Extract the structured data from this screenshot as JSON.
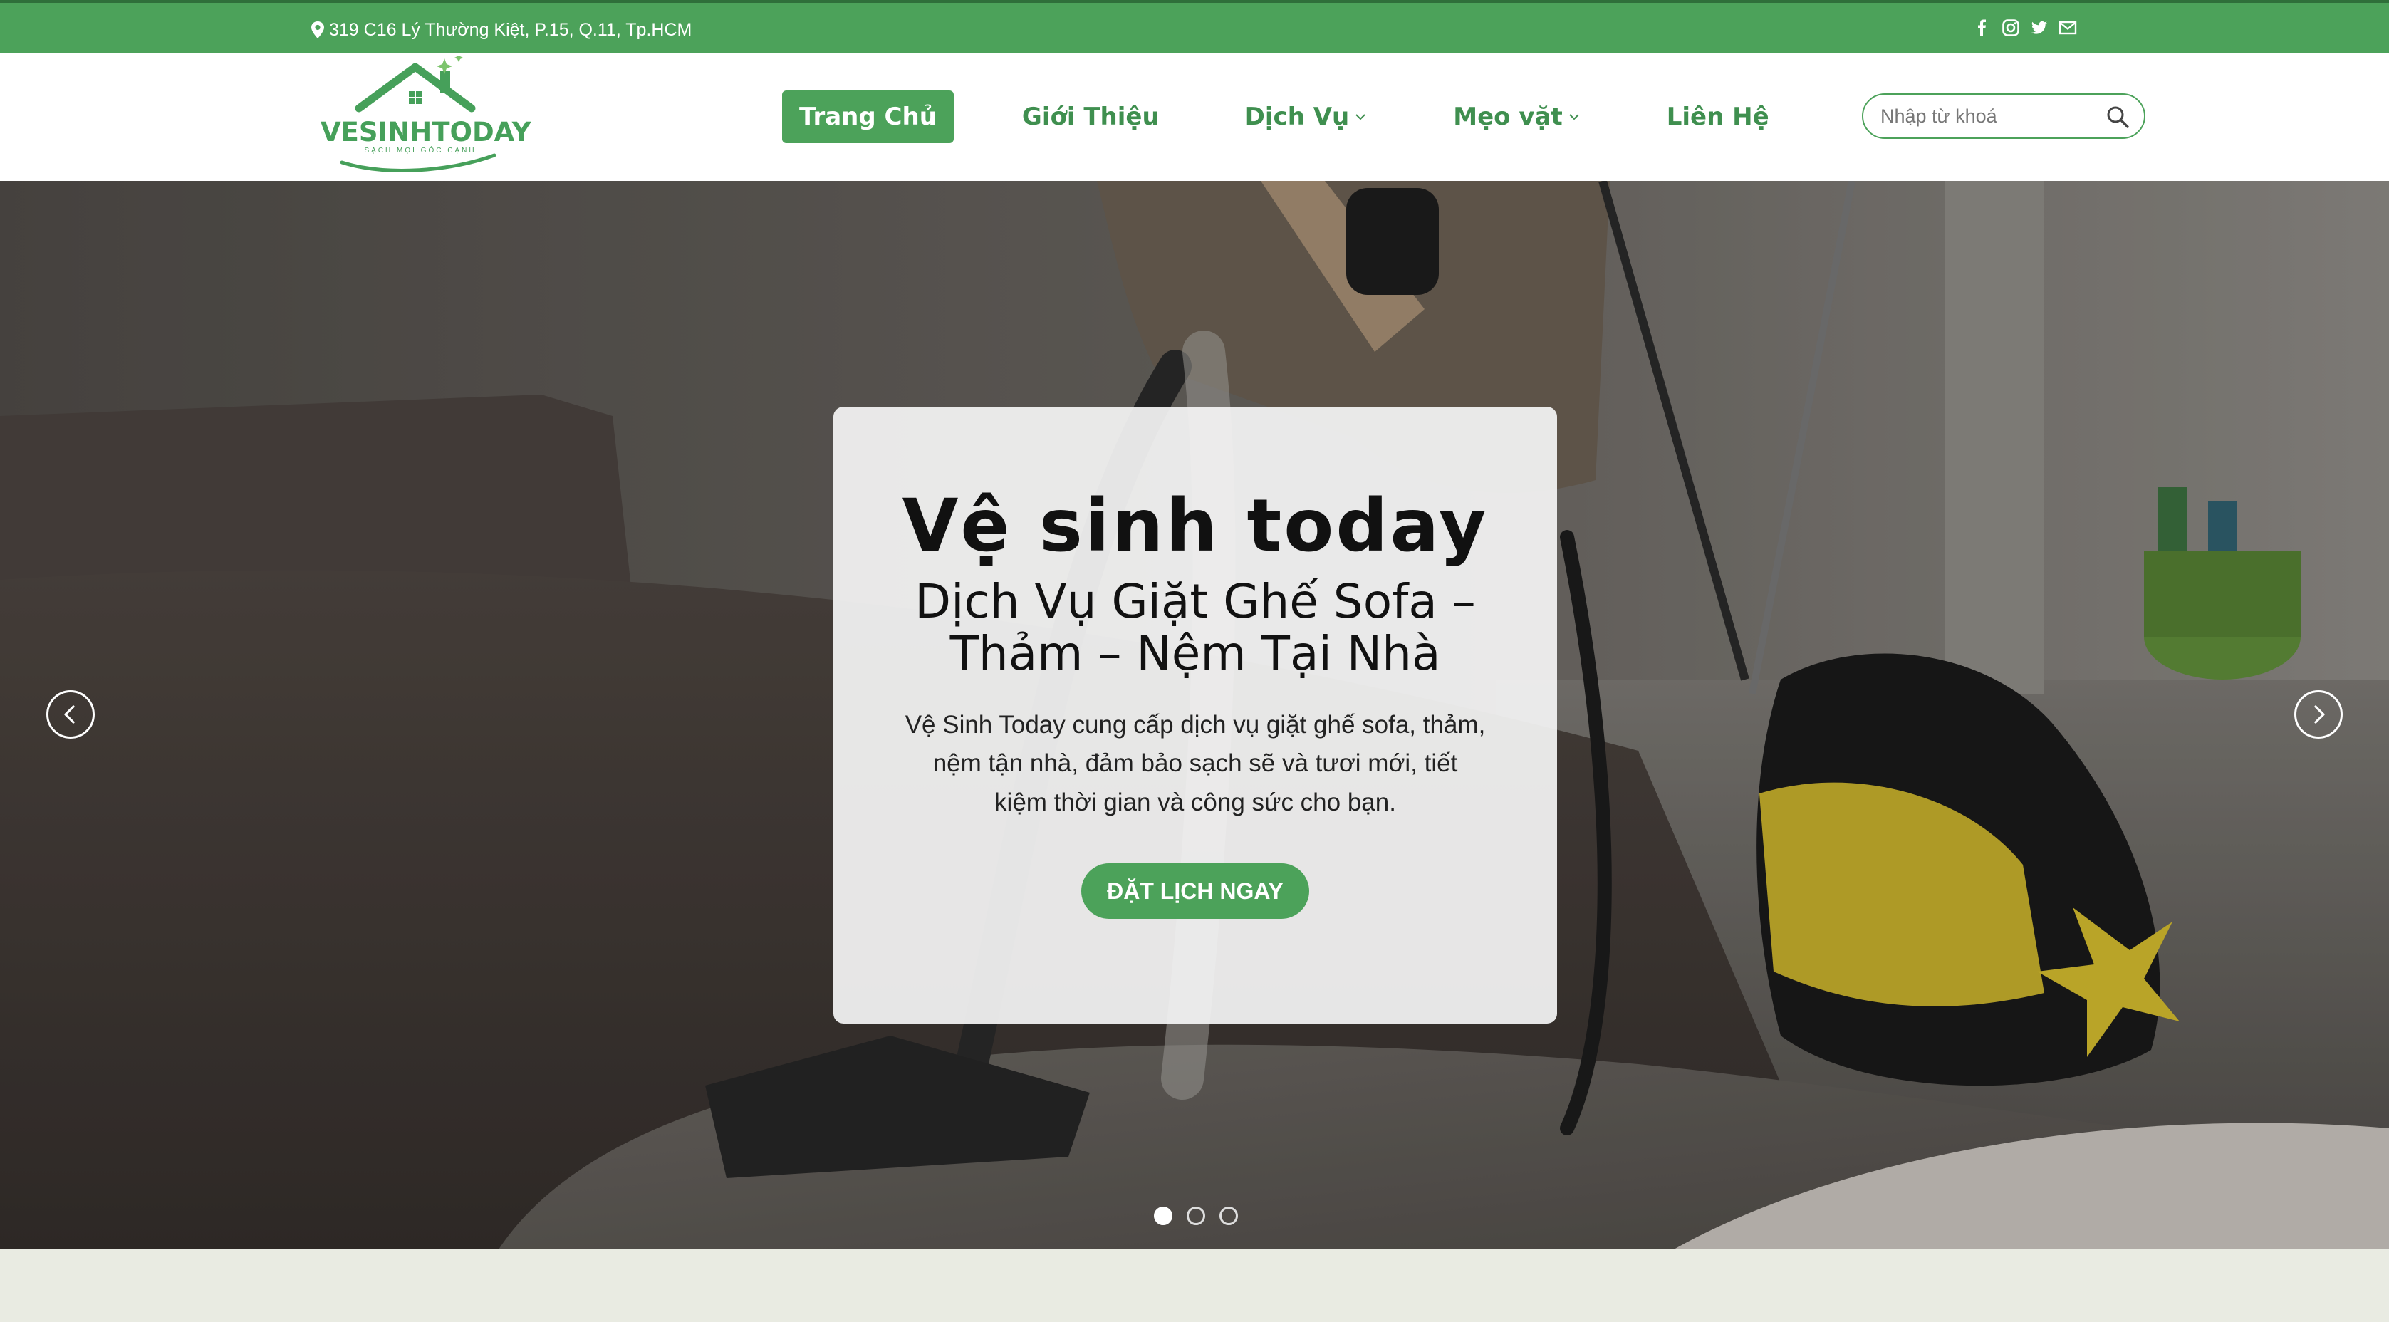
{
  "topbar": {
    "address": "319 C16 Lý Thường Kiệt, P.15, Q.11, Tp.HCM",
    "address_icon": "map-pin-icon",
    "social_icons": [
      "facebook-icon",
      "instagram-icon",
      "twitter-icon",
      "email-icon"
    ]
  },
  "logo": {
    "name": "VESINHTODAY",
    "tagline": "SẠCH MỌI GÓC CẠNH"
  },
  "nav": {
    "items": [
      {
        "label": "Trang Chủ",
        "active": true,
        "dropdown": false
      },
      {
        "label": "Giới Thiệu",
        "active": false,
        "dropdown": false
      },
      {
        "label": "Dịch Vụ",
        "active": false,
        "dropdown": true
      },
      {
        "label": "Mẹo vặt",
        "active": false,
        "dropdown": true
      },
      {
        "label": "Liên Hệ",
        "active": false,
        "dropdown": false
      }
    ]
  },
  "search": {
    "placeholder": "Nhập từ khoá",
    "value": ""
  },
  "hero": {
    "title": "Vệ sinh today",
    "subtitle": "Dịch Vụ Giặt Ghế Sofa – Thảm – Nệm Tại Nhà",
    "description": "Vệ Sinh Today cung cấp dịch vụ giặt ghế sofa, thảm, nệm tận nhà, đảm bảo sạch sẽ và tươi mới, tiết kiệm thời gian và công sức cho bạn.",
    "cta_label": "ĐẶT LỊCH NGAY",
    "slide_count": 3,
    "active_slide": 1
  },
  "colors": {
    "brand_green": "#4ca25a",
    "topbar_border": "#2f6f3a",
    "section_bg": "#e9ebe2"
  }
}
